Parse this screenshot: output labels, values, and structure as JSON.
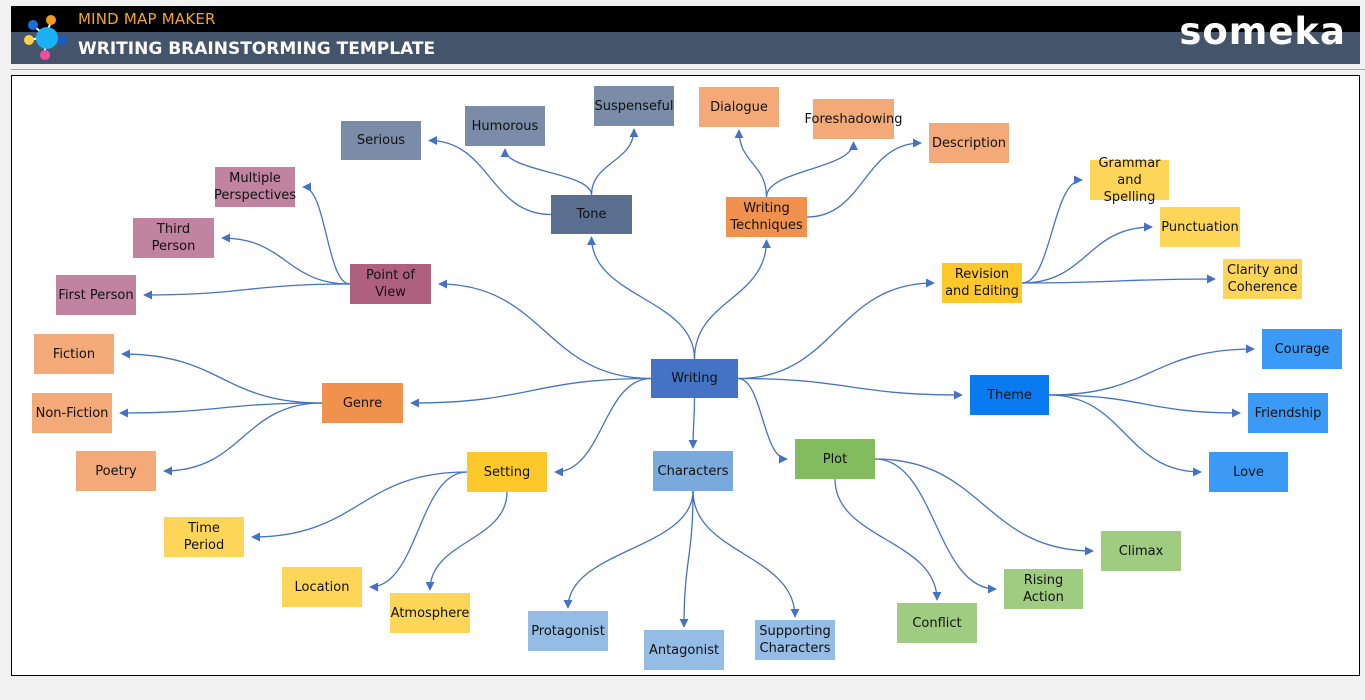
{
  "header": {
    "app_name": "MIND MAP MAKER",
    "title": "WRITING BRAINSTORMING TEMPLATE",
    "brand": "someka",
    "logo_icon": "mind-map-network-icon"
  },
  "colors": {
    "connector": "#4472c4",
    "header_black": "#000000",
    "header_slate": "#44546a",
    "app_name": "#f5a623"
  },
  "mindmap": {
    "root": {
      "id": "writing",
      "label": "Writing",
      "color": "#4472c4"
    },
    "branches": [
      {
        "id": "tone",
        "label": "Tone",
        "color": "#5a6f8f",
        "children": [
          {
            "id": "serious",
            "label": "Serious",
            "color": "#7a8ca8"
          },
          {
            "id": "humorous",
            "label": "Humorous",
            "color": "#7a8ca8"
          },
          {
            "id": "suspenseful",
            "label": "Suspenseful",
            "color": "#7a8ca8"
          }
        ]
      },
      {
        "id": "writing-techniques",
        "label": "Writing Techniques",
        "color": "#f0924e",
        "children": [
          {
            "id": "dialogue",
            "label": "Dialogue",
            "color": "#f4aa78"
          },
          {
            "id": "foreshadowing",
            "label": "Foreshadowing",
            "color": "#f4aa78"
          },
          {
            "id": "description",
            "label": "Description",
            "color": "#f4aa78"
          }
        ]
      },
      {
        "id": "point-of-view",
        "label": "Point of View",
        "color": "#b0607f",
        "children": [
          {
            "id": "multiple-perspectives",
            "label": "Multiple Perspectives",
            "color": "#c083a0"
          },
          {
            "id": "third-person",
            "label": "Third Person",
            "color": "#c083a0"
          },
          {
            "id": "first-person",
            "label": "First Person",
            "color": "#c083a0"
          }
        ]
      },
      {
        "id": "revision-and-editing",
        "label": "Revision and Editing",
        "color": "#fdc92a",
        "children": [
          {
            "id": "grammar-and-spelling",
            "label": "Grammar and Spelling",
            "color": "#fdd659"
          },
          {
            "id": "punctuation",
            "label": "Punctuation",
            "color": "#fdd659"
          },
          {
            "id": "clarity-and-coherence",
            "label": "Clarity and Coherence",
            "color": "#fdd659"
          }
        ]
      },
      {
        "id": "genre",
        "label": "Genre",
        "color": "#f0924e",
        "children": [
          {
            "id": "fiction",
            "label": "Fiction",
            "color": "#f4aa78"
          },
          {
            "id": "non-fiction",
            "label": "Non-Fiction",
            "color": "#f4aa78"
          },
          {
            "id": "poetry",
            "label": "Poetry",
            "color": "#f4aa78"
          }
        ]
      },
      {
        "id": "theme",
        "label": "Theme",
        "color": "#0a7af0",
        "children": [
          {
            "id": "courage",
            "label": "Courage",
            "color": "#3a9af5"
          },
          {
            "id": "friendship",
            "label": "Friendship",
            "color": "#3a9af5"
          },
          {
            "id": "love",
            "label": "Love",
            "color": "#3a9af5"
          }
        ]
      },
      {
        "id": "setting",
        "label": "Setting",
        "color": "#fdc92a",
        "children": [
          {
            "id": "time-period",
            "label": "Time Period",
            "color": "#fdd659"
          },
          {
            "id": "location",
            "label": "Location",
            "color": "#fdd659"
          },
          {
            "id": "atmosphere",
            "label": "Atmosphere",
            "color": "#fdd659"
          }
        ]
      },
      {
        "id": "characters",
        "label": "Characters",
        "color": "#7aaadb",
        "children": [
          {
            "id": "protagonist",
            "label": "Protagonist",
            "color": "#94bce5"
          },
          {
            "id": "antagonist",
            "label": "Antagonist",
            "color": "#94bce5"
          },
          {
            "id": "supporting-characters",
            "label": "Supporting Characters",
            "color": "#94bce5"
          }
        ]
      },
      {
        "id": "plot",
        "label": "Plot",
        "color": "#82bc5f",
        "children": [
          {
            "id": "conflict",
            "label": "Conflict",
            "color": "#a0cc82"
          },
          {
            "id": "rising-action",
            "label": "Rising Action",
            "color": "#a0cc82"
          },
          {
            "id": "climax",
            "label": "Climax",
            "color": "#a0cc82"
          }
        ]
      }
    ]
  }
}
